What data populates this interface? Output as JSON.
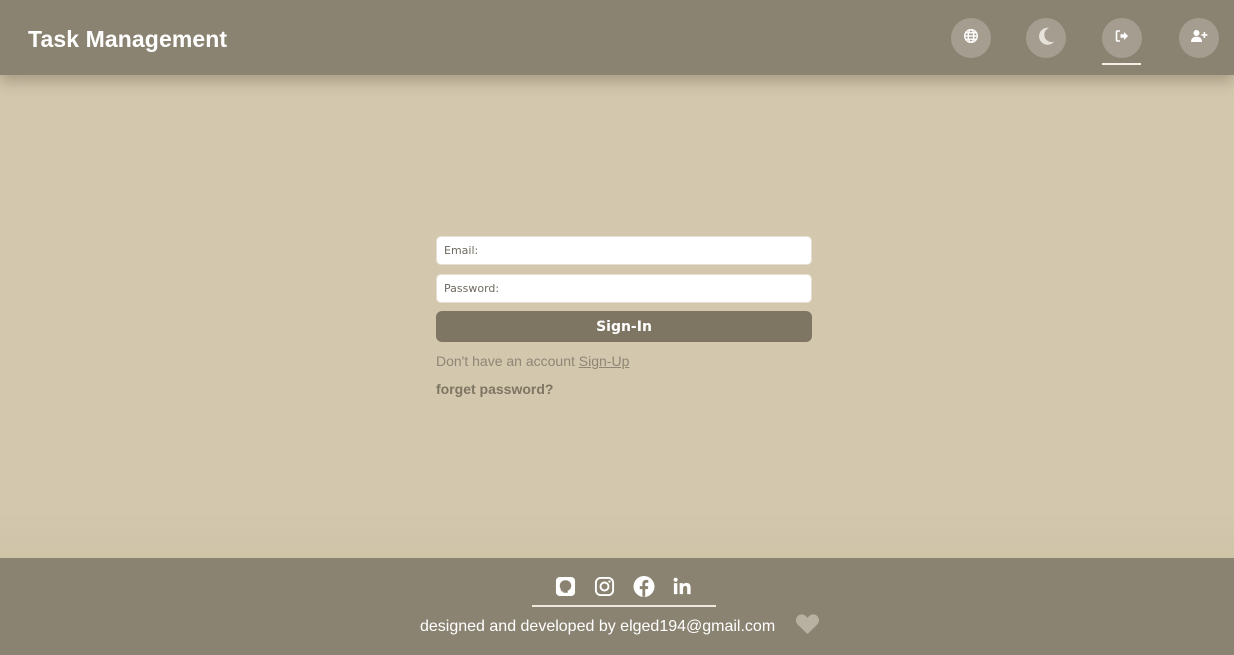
{
  "header": {
    "title": "Task Management",
    "nav": [
      {
        "icon": "globe-icon"
      },
      {
        "icon": "moon-icon"
      },
      {
        "icon": "sign-in-icon",
        "active": true
      },
      {
        "icon": "user-plus-icon"
      }
    ]
  },
  "form": {
    "email_placeholder": "Email:",
    "password_placeholder": "Password:",
    "submit_label": "Sign-In",
    "no_account_text": "Don't have an account",
    "signup_link": "Sign-Up",
    "forget_password": "forget password?"
  },
  "footer": {
    "social": [
      "github-icon",
      "instagram-icon",
      "facebook-icon",
      "linkedin-icon"
    ],
    "credit": "designed and developed by elged194@gmail.com",
    "heart_icon": "heart-icon"
  },
  "colors": {
    "header_bg": "#8b8371",
    "page_bg": "#d3c8ae",
    "button_bg": "#7e7563",
    "nav_circle": "#a59d8f"
  }
}
